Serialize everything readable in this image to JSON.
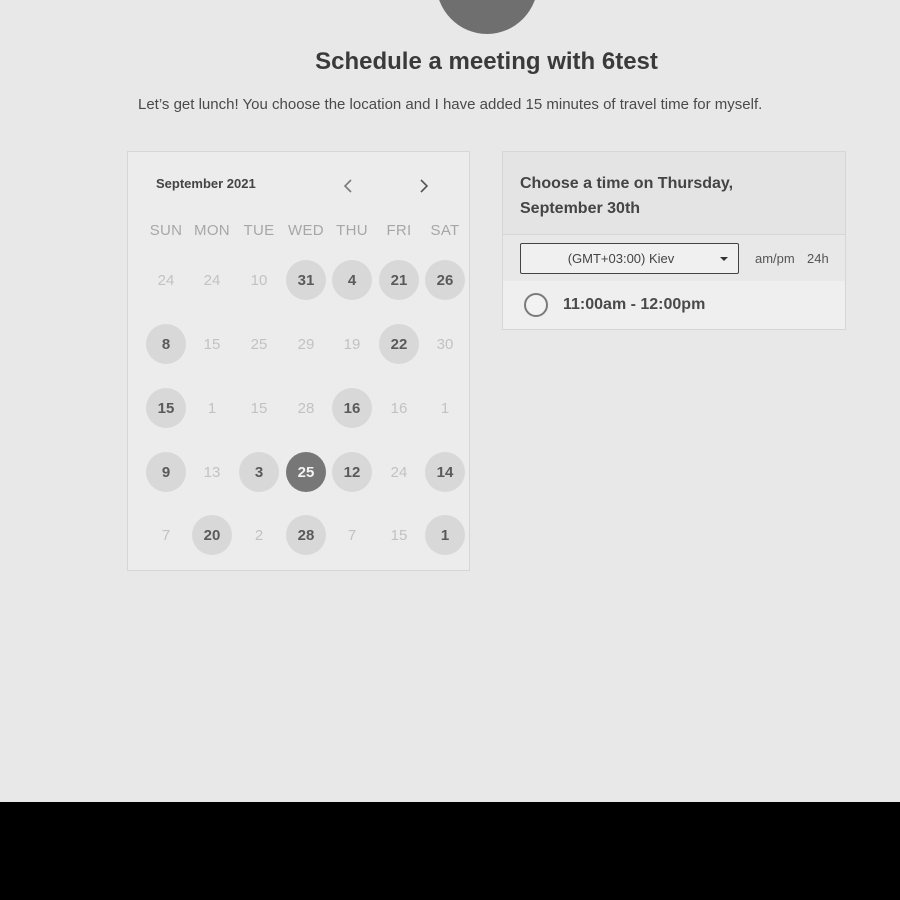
{
  "header": {
    "title": "Schedule a meeting with 6test",
    "description": "Let’s get lunch! You choose the location and I have added 15 minutes of travel time for myself."
  },
  "calendar": {
    "month": "September 2021",
    "prev_icon": "chevron-left-icon",
    "next_icon": "chevron-right-icon",
    "weekdays": [
      "SUN",
      "MON",
      "TUE",
      "WED",
      "THU",
      "FRI",
      "SAT"
    ],
    "weeks": [
      [
        {
          "label": "24",
          "state": "disabled"
        },
        {
          "label": "24",
          "state": "disabled"
        },
        {
          "label": "10",
          "state": "disabled"
        },
        {
          "label": "31",
          "state": "available"
        },
        {
          "label": "4",
          "state": "available"
        },
        {
          "label": "21",
          "state": "available"
        },
        {
          "label": "26",
          "state": "available"
        }
      ],
      [
        {
          "label": "8",
          "state": "available"
        },
        {
          "label": "15",
          "state": "disabled"
        },
        {
          "label": "25",
          "state": "disabled"
        },
        {
          "label": "29",
          "state": "disabled"
        },
        {
          "label": "19",
          "state": "disabled"
        },
        {
          "label": "22",
          "state": "available"
        },
        {
          "label": "30",
          "state": "disabled"
        }
      ],
      [
        {
          "label": "15",
          "state": "available"
        },
        {
          "label": "1",
          "state": "disabled"
        },
        {
          "label": "15",
          "state": "disabled"
        },
        {
          "label": "28",
          "state": "disabled"
        },
        {
          "label": "16",
          "state": "available"
        },
        {
          "label": "16",
          "state": "disabled"
        },
        {
          "label": "1",
          "state": "disabled"
        }
      ],
      [
        {
          "label": "9",
          "state": "available"
        },
        {
          "label": "13",
          "state": "disabled"
        },
        {
          "label": "3",
          "state": "available"
        },
        {
          "label": "25",
          "state": "selected"
        },
        {
          "label": "12",
          "state": "available"
        },
        {
          "label": "24",
          "state": "disabled"
        },
        {
          "label": "14",
          "state": "available"
        }
      ],
      [
        {
          "label": "7",
          "state": "disabled"
        },
        {
          "label": "20",
          "state": "available"
        },
        {
          "label": "2",
          "state": "disabled"
        },
        {
          "label": "28",
          "state": "available"
        },
        {
          "label": "7",
          "state": "disabled"
        },
        {
          "label": "15",
          "state": "disabled"
        },
        {
          "label": "1",
          "state": "available"
        }
      ]
    ]
  },
  "time_panel": {
    "title": "Choose a time on Thursday, September 30th",
    "timezone": "(GMT+03:00) Kiev",
    "format_ampm": "am/pm",
    "format_24h": "24h",
    "slots": [
      "11:00am - 12:00pm"
    ]
  },
  "colors": {
    "background": "#e8e8e8",
    "selected_day": "#777777",
    "available_day": "#d8d8d8"
  }
}
